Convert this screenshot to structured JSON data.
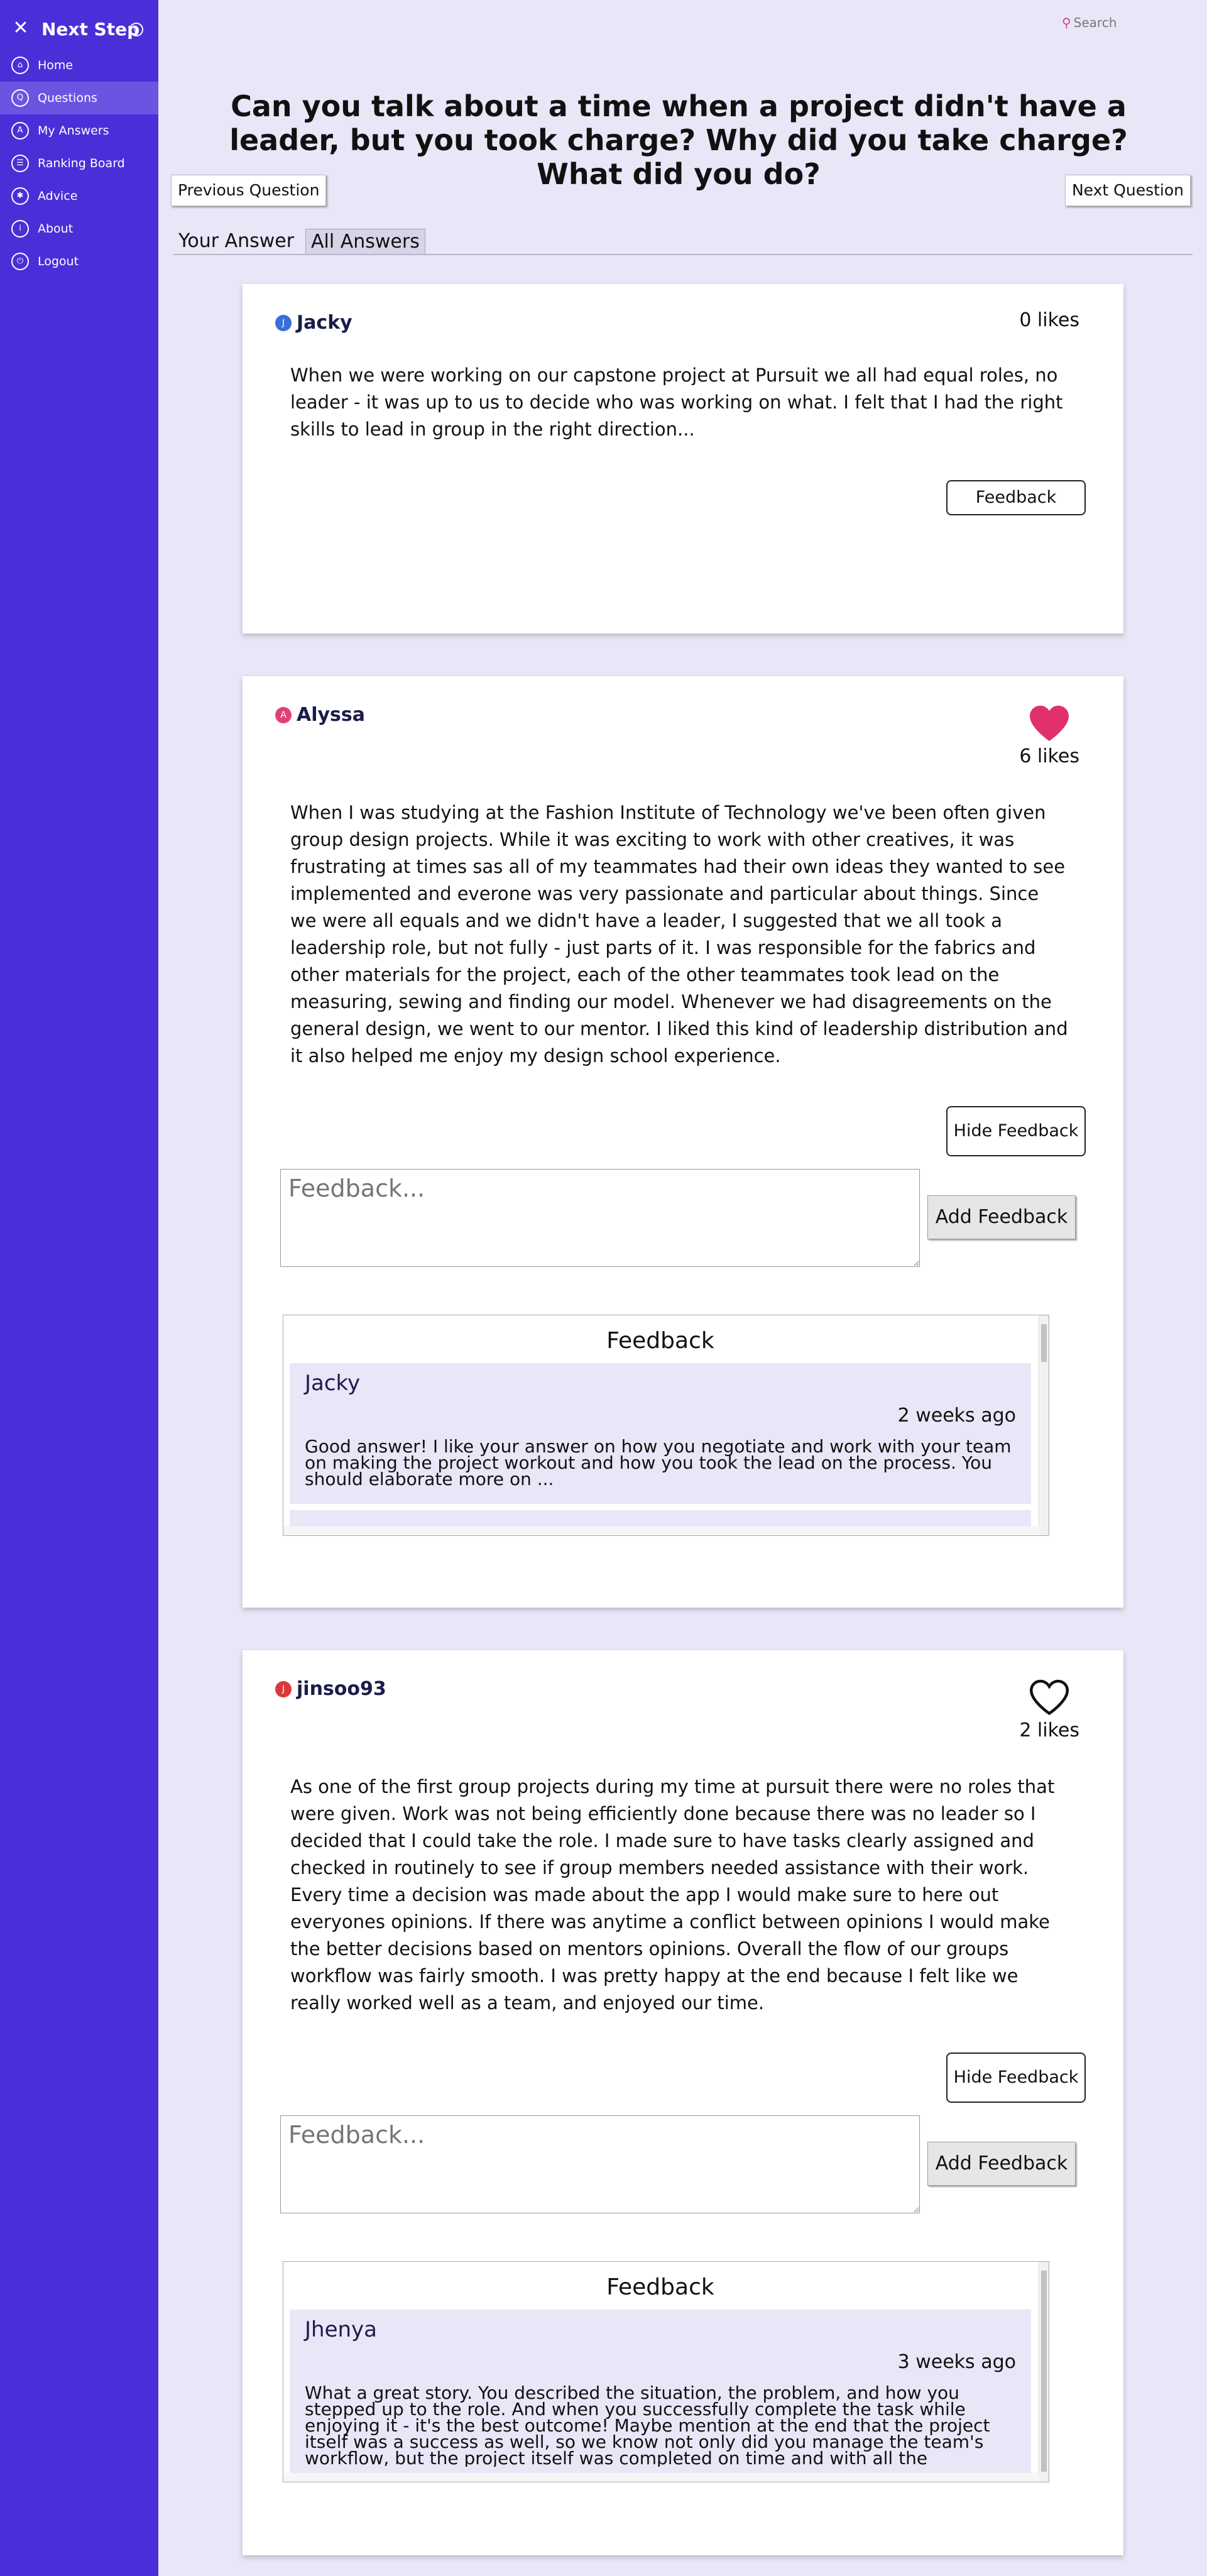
{
  "sidebar": {
    "title": "Next Step",
    "items": [
      {
        "label": "Home",
        "icon": "home-icon",
        "glyph": "⌂",
        "active": false
      },
      {
        "label": "Questions",
        "icon": "questions-icon",
        "glyph": "Q",
        "active": true
      },
      {
        "label": "My Answers",
        "icon": "my-answers-icon",
        "glyph": "A",
        "active": false
      },
      {
        "label": "Ranking Board",
        "icon": "ranking-board-icon",
        "glyph": "☰",
        "active": false
      },
      {
        "label": "Advice",
        "icon": "advice-icon",
        "glyph": "✱",
        "active": false
      },
      {
        "label": "About",
        "icon": "about-icon",
        "glyph": "i",
        "active": false
      },
      {
        "label": "Logout",
        "icon": "logout-icon",
        "glyph": "⏻",
        "active": false
      }
    ]
  },
  "header": {
    "search_label": "Search",
    "question": "Can you talk about a time when a project didn't have a leader, but you took charge? Why did you take charge? What did you do?",
    "prev_label": "Previous Question",
    "next_label": "Next Question",
    "tabs": [
      "Your Answer",
      "All Answers"
    ]
  },
  "answers": [
    {
      "user": "Jacky",
      "avatar_letter": "J",
      "avatar_color": "#3a6fd8",
      "likes": "0 likes",
      "liked": null,
      "text": "When we were working on our capstone project at Pursuit we all had equal roles, no leader - it was up to us to decide who was working on what. I felt that I had the right skills to lead in group in the right direction...",
      "feedback_toggle": "Feedback"
    },
    {
      "user": "Alyssa",
      "avatar_letter": "A",
      "avatar_color": "#e0407a",
      "likes": "6 likes",
      "liked": true,
      "text": "When I was studying at the Fashion Institute of Technology we've been often given group design projects. While it was exciting to work with other creatives, it was frustrating at times sas all of my teammates had their own ideas they wanted to see implemented and everone was very passionate and particular about things. Since we were all equals and we didn't have a leader, I suggested that we all took a leadership role, but not fully - just parts of it. I was responsible for the fabrics and other materials for the project, each of the other teammates took lead on the measuring, sewing and finding our model. Whenever we had disagreements on the general design, we went to our mentor. I liked this kind of leadership distribution and it also helped me enjoy my design school experience.",
      "feedback_toggle": "Hide Feedback",
      "feedback_placeholder": "Feedback...",
      "add_feedback": "Add Feedback",
      "feedback_title": "Feedback",
      "feedback": {
        "author": "Jacky",
        "time": "2 weeks ago",
        "text": "Good answer! I like your answer on how you negotiate and work with your team on making the project workout and how you took the lead on the process. You should elaborate more on ..."
      }
    },
    {
      "user": "jinsoo93",
      "avatar_letter": "J",
      "avatar_color": "#d83a3a",
      "likes": "2 likes",
      "liked": false,
      "text": "As one of the first group projects during my time at pursuit there were no roles that were given. Work was not being efficiently done because there was no leader so I decided that I could take the role. I made sure to have tasks clearly assigned and checked in routinely to see if group members needed assistance with their work. Every time a decision was made about the app I would make sure to here out everyones opinions. If there was anytime a conflict between opinions I would make the better decisions based on mentors opinions. Overall the flow of our groups workflow was fairly smooth. I was pretty happy at the end because I felt like we really worked well as a team, and enjoyed our time.",
      "feedback_toggle": "Hide Feedback",
      "feedback_placeholder": "Feedback...",
      "add_feedback": "Add Feedback",
      "feedback_title": "Feedback",
      "feedback": {
        "author": "Jhenya",
        "time": "3 weeks ago",
        "text": "What a great story. You described the situation, the problem, and how you stepped up to the role. And when you successfully complete the task while enjoying it - it's the best outcome! Maybe mention at the end that the project itself was a success as well, so we know not only did you manage the team's workflow, but the project itself was completed on time and with all the"
      }
    }
  ]
}
